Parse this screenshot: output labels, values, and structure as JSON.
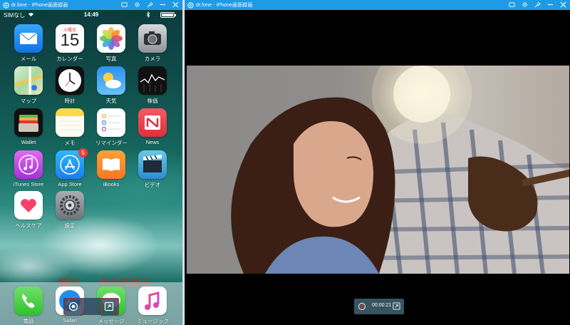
{
  "left_window": {
    "title": "dr.fone - iPhone画面録画",
    "controls": [
      "cast-icon",
      "gear-icon",
      "pin-icon",
      "minimize-icon",
      "close-icon"
    ]
  },
  "right_window": {
    "title": "dr.fone - iPhone画面録画",
    "controls": [
      "cast-icon",
      "gear-icon",
      "pin-icon",
      "minimize-icon",
      "close-icon"
    ]
  },
  "status_bar": {
    "carrier": "SIMなし",
    "time": "14:49"
  },
  "apps": [
    {
      "label": "メール",
      "icon": "mail-icon"
    },
    {
      "label": "カレンダー",
      "icon": "calendar-icon",
      "weekday": "火曜日",
      "day": "15"
    },
    {
      "label": "写真",
      "icon": "photos-icon"
    },
    {
      "label": "カメラ",
      "icon": "camera-icon"
    },
    {
      "label": "マップ",
      "icon": "maps-icon"
    },
    {
      "label": "時計",
      "icon": "clock-icon"
    },
    {
      "label": "天気",
      "icon": "weather-icon"
    },
    {
      "label": "株価",
      "icon": "stocks-icon"
    },
    {
      "label": "Wallet",
      "icon": "wallet-icon"
    },
    {
      "label": "メモ",
      "icon": "notes-icon"
    },
    {
      "label": "リマインダー",
      "icon": "reminders-icon"
    },
    {
      "label": "News",
      "icon": "news-icon"
    },
    {
      "label": "iTunes Store",
      "icon": "itunes-store-icon"
    },
    {
      "label": "App Store",
      "icon": "app-store-icon",
      "badge": "5"
    },
    {
      "label": "iBooks",
      "icon": "ibooks-icon"
    },
    {
      "label": "ビデオ",
      "icon": "videos-icon"
    },
    {
      "label": "ヘルスケア",
      "icon": "health-icon"
    },
    {
      "label": "設定",
      "icon": "settings-icon"
    }
  ],
  "dock": [
    {
      "label": "電話",
      "icon": "phone-icon"
    },
    {
      "label": "Safari",
      "icon": "safari-icon"
    },
    {
      "label": "メッセージ",
      "icon": "messages-icon"
    },
    {
      "label": "ミュージック",
      "icon": "music-icon"
    }
  ],
  "annotations": {
    "record": "録画",
    "fullscreen": "全画面表示"
  },
  "recording": {
    "timer": "00:00:21"
  },
  "colors": {
    "titlebar": "#1e9be6",
    "annotation": "#e6170e",
    "record_dot": "#e8232a"
  }
}
